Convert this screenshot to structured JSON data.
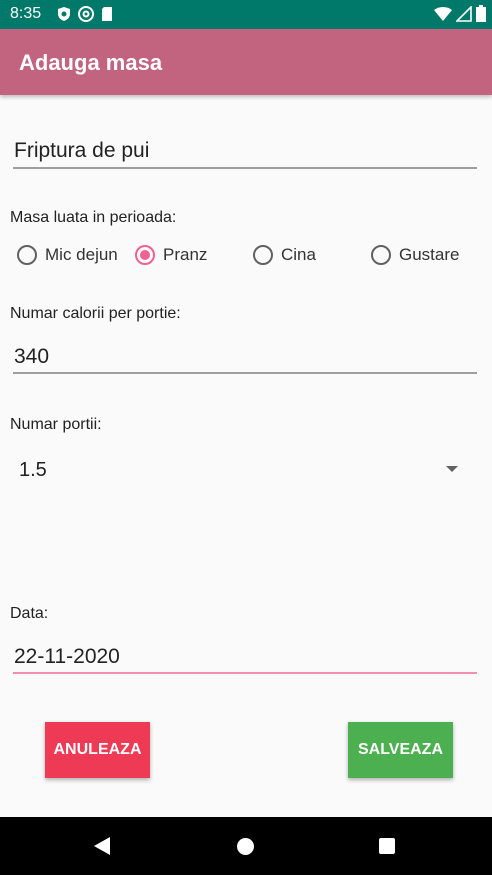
{
  "status_bar": {
    "time": "8:35",
    "left_icons": [
      "shield-icon",
      "at-sign-icon",
      "sd-card-icon"
    ],
    "right_icons": [
      "wifi-icon",
      "signal-icon",
      "battery-icon"
    ]
  },
  "app_bar": {
    "title": "Adauga masa"
  },
  "meal_name": {
    "value": "Friptura de pui"
  },
  "period": {
    "label": "Masa luata in perioada:",
    "options": [
      {
        "label": "Mic dejun",
        "checked": false
      },
      {
        "label": "Pranz",
        "checked": true
      },
      {
        "label": "Cina",
        "checked": false
      },
      {
        "label": "Gustare",
        "checked": false
      }
    ]
  },
  "calories": {
    "label": "Numar calorii per portie:",
    "value": "340"
  },
  "portions": {
    "label": "Numar portii:",
    "selected": "1.5"
  },
  "date": {
    "label": "Data:",
    "value": "22-11-2020"
  },
  "buttons": {
    "cancel": "ANULEAZA",
    "save": "SALVEAZA"
  },
  "colors": {
    "status_bar": "#00796b",
    "app_bar": "#c2637f",
    "accent": "#f06292",
    "cancel_button": "#ee3a55",
    "save_button": "#4caf50"
  }
}
